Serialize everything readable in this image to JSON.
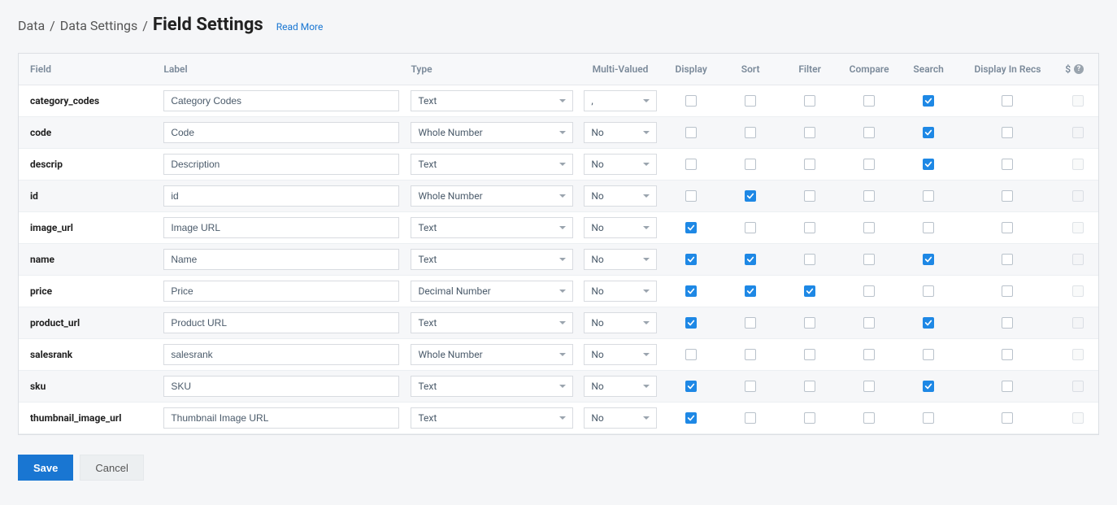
{
  "breadcrumb": {
    "crumb1": "Data",
    "crumb2": "Data Settings",
    "current": "Field Settings",
    "read_more": "Read More"
  },
  "headers": {
    "field": "Field",
    "label": "Label",
    "type": "Type",
    "multi_valued": "Multi-Valued",
    "display": "Display",
    "sort": "Sort",
    "filter": "Filter",
    "compare": "Compare",
    "search": "Search",
    "display_in_recs": "Display In Recs",
    "dollar": "$"
  },
  "rows": [
    {
      "field": "category_codes",
      "label": "Category Codes",
      "type": "Text",
      "mv": ",",
      "display": false,
      "sort": false,
      "filter": false,
      "compare": false,
      "search": true,
      "recs": false,
      "dollar_disabled": true
    },
    {
      "field": "code",
      "label": "Code",
      "type": "Whole Number",
      "mv": "No",
      "display": false,
      "sort": false,
      "filter": false,
      "compare": false,
      "search": true,
      "recs": false,
      "dollar_disabled": true
    },
    {
      "field": "descrip",
      "label": "Description",
      "type": "Text",
      "mv": "No",
      "display": false,
      "sort": false,
      "filter": false,
      "compare": false,
      "search": true,
      "recs": false,
      "dollar_disabled": true
    },
    {
      "field": "id",
      "label": "id",
      "type": "Whole Number",
      "mv": "No",
      "display": false,
      "sort": true,
      "filter": false,
      "compare": false,
      "search": false,
      "recs": false,
      "dollar_disabled": true
    },
    {
      "field": "image_url",
      "label": "Image URL",
      "type": "Text",
      "mv": "No",
      "display": true,
      "sort": false,
      "filter": false,
      "compare": false,
      "search": false,
      "recs": false,
      "dollar_disabled": true
    },
    {
      "field": "name",
      "label": "Name",
      "type": "Text",
      "mv": "No",
      "display": true,
      "sort": true,
      "filter": false,
      "compare": false,
      "search": true,
      "recs": false,
      "dollar_disabled": true
    },
    {
      "field": "price",
      "label": "Price",
      "type": "Decimal Number",
      "mv": "No",
      "display": true,
      "sort": true,
      "filter": true,
      "compare": false,
      "search": false,
      "recs": false,
      "dollar_disabled": true
    },
    {
      "field": "product_url",
      "label": "Product URL",
      "type": "Text",
      "mv": "No",
      "display": true,
      "sort": false,
      "filter": false,
      "compare": false,
      "search": true,
      "recs": false,
      "dollar_disabled": true
    },
    {
      "field": "salesrank",
      "label": "salesrank",
      "type": "Whole Number",
      "mv": "No",
      "display": false,
      "sort": false,
      "filter": false,
      "compare": false,
      "search": false,
      "recs": false,
      "dollar_disabled": true
    },
    {
      "field": "sku",
      "label": "SKU",
      "type": "Text",
      "mv": "No",
      "display": true,
      "sort": false,
      "filter": false,
      "compare": false,
      "search": true,
      "recs": false,
      "dollar_disabled": true
    },
    {
      "field": "thumbnail_image_url",
      "label": "Thumbnail Image URL",
      "type": "Text",
      "mv": "No",
      "display": true,
      "sort": false,
      "filter": false,
      "compare": false,
      "search": false,
      "recs": false,
      "dollar_disabled": true
    }
  ],
  "actions": {
    "save": "Save",
    "cancel": "Cancel"
  }
}
